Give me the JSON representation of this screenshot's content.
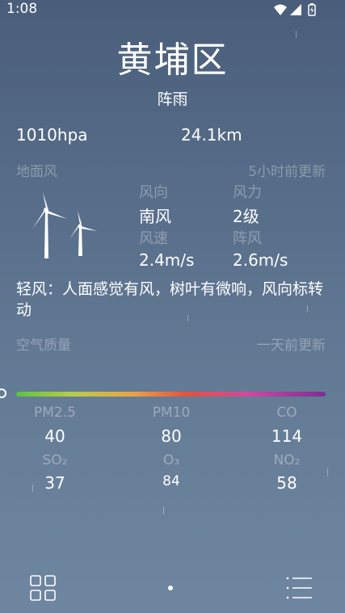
{
  "status_bar": {
    "time": "1:08",
    "icons": [
      "wifi-icon",
      "signal-icon",
      "battery-charging-icon"
    ]
  },
  "location": {
    "city": "黄埔区",
    "condition": "阵雨"
  },
  "metrics": {
    "pressure": "1010hpa",
    "visibility": "24.1km"
  },
  "wind": {
    "title": "地面风",
    "updated": "5小时前更新",
    "direction_label": "风向",
    "direction_value": "南风",
    "force_label": "风力",
    "force_value": "2级",
    "speed_label": "风速",
    "speed_value": "2.4m/s",
    "gust_label": "阵风",
    "gust_value": "2.6m/s",
    "description": "轻风：人面感觉有风，树叶有微响，风向标转动"
  },
  "air_quality": {
    "title": "空气质量",
    "updated": "一天前更新",
    "aqi_position_fraction": 0.0,
    "pollutants": [
      {
        "name": "PM2.5",
        "value": "40"
      },
      {
        "name": "PM10",
        "value": "80"
      },
      {
        "name": "CO",
        "value": "114"
      },
      {
        "name": "SO₂",
        "value": "37"
      },
      {
        "name": "O₃",
        "value": "84"
      },
      {
        "name": "NO₂",
        "value": "58"
      }
    ]
  },
  "nav": {
    "left_icon": "grid-icon",
    "right_icon": "list-icon"
  }
}
